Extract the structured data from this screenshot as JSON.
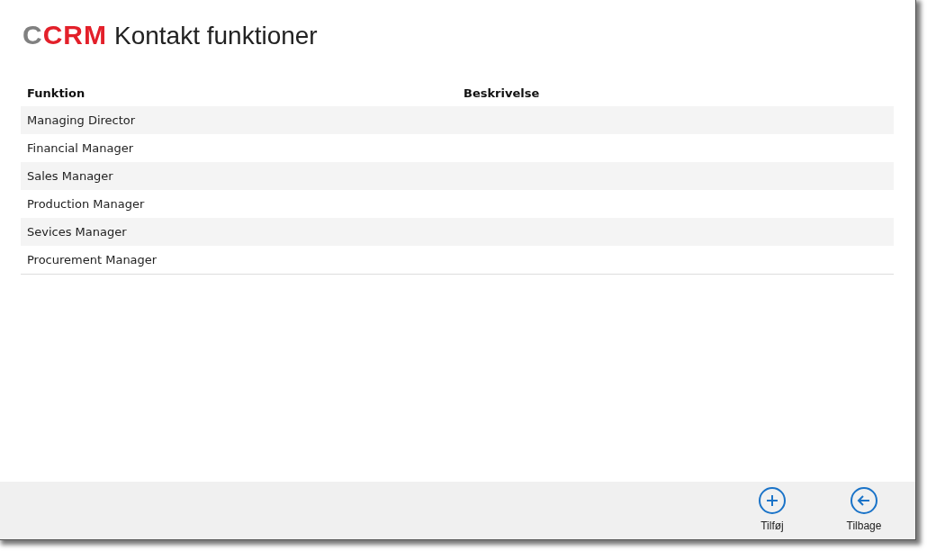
{
  "header": {
    "logo": {
      "first": "C",
      "rest": "CRM"
    },
    "title": "Kontakt funktioner"
  },
  "table": {
    "columns": [
      "Funktion",
      "Beskrivelse"
    ],
    "rows": [
      {
        "cells": [
          "Managing Director",
          ""
        ]
      },
      {
        "cells": [
          "Financial Manager",
          ""
        ]
      },
      {
        "cells": [
          "Sales Manager",
          ""
        ]
      },
      {
        "cells": [
          "Production Manager",
          ""
        ]
      },
      {
        "cells": [
          "Sevices Manager",
          ""
        ]
      },
      {
        "cells": [
          "Procurement Manager",
          ""
        ]
      }
    ]
  },
  "app_bar": {
    "buttons": [
      {
        "kind": "add",
        "label": "Tilføj"
      },
      {
        "kind": "back",
        "label": "Tilbage"
      }
    ]
  }
}
